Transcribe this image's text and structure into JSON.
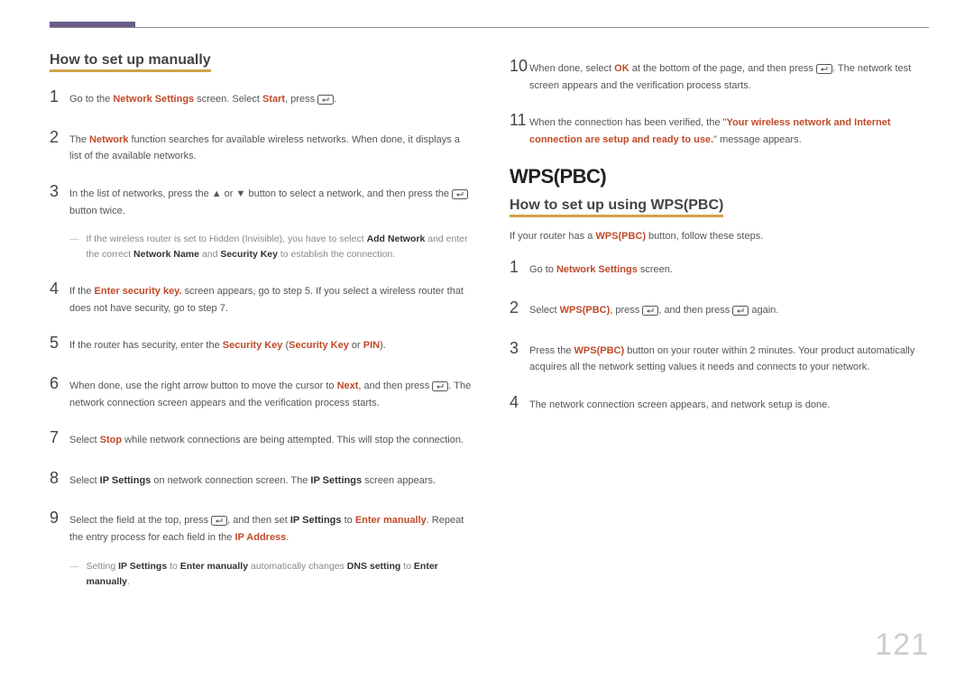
{
  "page_number": "121",
  "left": {
    "heading": "How to set up manually",
    "steps": [
      {
        "n": "1",
        "parts": [
          {
            "t": "Go to the "
          },
          {
            "b": "Network Settings",
            "k": true
          },
          {
            "t": " screen. Select "
          },
          {
            "b": "Start",
            "k": true
          },
          {
            "t": ", press "
          },
          {
            "icon": "enter"
          },
          {
            "t": "."
          }
        ]
      },
      {
        "n": "2",
        "parts": [
          {
            "t": "The "
          },
          {
            "b": "Network",
            "k": true
          },
          {
            "t": " function searches for available wireless networks. When done, it displays a list of the available networks."
          }
        ]
      },
      {
        "n": "3",
        "parts": [
          {
            "t": "In the list of networks, press the ▲ or ▼ button to select a network, and then press the  "
          },
          {
            "icon": "enter"
          },
          {
            "t": " button twice."
          }
        ]
      },
      {
        "note": true,
        "parts": [
          {
            "t": "If the wireless router is set to Hidden (Invisible), you have to select "
          },
          {
            "b": "Add Network"
          },
          {
            "t": " and enter the correct "
          },
          {
            "b": "Network Name"
          },
          {
            "t": " and "
          },
          {
            "b": "Security Key"
          },
          {
            "t": " to establish the connection."
          }
        ]
      },
      {
        "n": "4",
        "parts": [
          {
            "t": "If the "
          },
          {
            "b": "Enter security key.",
            "k": true
          },
          {
            "t": " screen appears, go to step 5. If you select a wireless router that does not have security, go to step 7."
          }
        ]
      },
      {
        "n": "5",
        "parts": [
          {
            "t": "If the router has security, enter the "
          },
          {
            "b": "Security Key",
            "k": true
          },
          {
            "t": " ("
          },
          {
            "b": "Security Key",
            "k": true
          },
          {
            "t": " or "
          },
          {
            "b": "PIN",
            "k": true
          },
          {
            "t": ")."
          }
        ]
      },
      {
        "n": "6",
        "parts": [
          {
            "t": "When done, use the right arrow button to move the cursor to "
          },
          {
            "b": "Next",
            "k": true
          },
          {
            "t": ", and then press "
          },
          {
            "icon": "enter"
          },
          {
            "t": ". The network connection screen appears and the verification process starts."
          }
        ]
      },
      {
        "n": "7",
        "parts": [
          {
            "t": "Select "
          },
          {
            "b": "Stop",
            "k": true
          },
          {
            "t": " while network connections are being attempted. This will stop the connection."
          }
        ]
      },
      {
        "n": "8",
        "parts": [
          {
            "t": "Select "
          },
          {
            "b": "IP Settings"
          },
          {
            "t": " on network connection screen. The "
          },
          {
            "b": "IP Settings"
          },
          {
            "t": " screen appears."
          }
        ]
      },
      {
        "n": "9",
        "parts": [
          {
            "t": "Select the field at the top, press "
          },
          {
            "icon": "enter"
          },
          {
            "t": ", and then set "
          },
          {
            "b": "IP Settings"
          },
          {
            "t": " to "
          },
          {
            "b": "Enter manually",
            "k": true
          },
          {
            "t": ". Repeat the entry process for each field in the "
          },
          {
            "b": "IP Address",
            "k": true
          },
          {
            "t": "."
          }
        ]
      },
      {
        "note": true,
        "parts": [
          {
            "t": "Setting "
          },
          {
            "b": "IP Settings"
          },
          {
            "t": " to "
          },
          {
            "b": "Enter manually"
          },
          {
            "t": " automatically changes "
          },
          {
            "b": "DNS setting"
          },
          {
            "t": " to "
          },
          {
            "b": "Enter manually"
          },
          {
            "t": "."
          }
        ]
      }
    ]
  },
  "right_top": {
    "steps": [
      {
        "n": "10",
        "parts": [
          {
            "t": "When done, select "
          },
          {
            "b": "OK",
            "k": true
          },
          {
            "t": " at the bottom of the page, and then press "
          },
          {
            "icon": "enter"
          },
          {
            "t": ". The network test screen appears and the verification process starts."
          }
        ]
      },
      {
        "n": "11",
        "parts": [
          {
            "t": "When the connection has been verified, the \""
          },
          {
            "b": "Your wireless network and Internet connection are setup and ready to use.",
            "k": true
          },
          {
            "t": "\" message appears."
          }
        ]
      }
    ]
  },
  "right_bottom": {
    "h2": "WPS(PBC)",
    "heading": "How to set up using WPS(PBC)",
    "intro_parts": [
      {
        "t": "If your router has a "
      },
      {
        "b": "WPS(PBC)",
        "k": true
      },
      {
        "t": " button, follow these steps."
      }
    ],
    "steps": [
      {
        "n": "1",
        "parts": [
          {
            "t": "Go to "
          },
          {
            "b": "Network Settings",
            "k": true
          },
          {
            "t": " screen."
          }
        ]
      },
      {
        "n": "2",
        "parts": [
          {
            "t": "Select "
          },
          {
            "b": "WPS(PBC)",
            "k": true
          },
          {
            "t": ", press  "
          },
          {
            "icon": "enter"
          },
          {
            "t": ", and then press "
          },
          {
            "icon": "enter"
          },
          {
            "t": " again."
          }
        ]
      },
      {
        "n": "3",
        "parts": [
          {
            "t": "Press the "
          },
          {
            "b": "WPS(PBC)",
            "k": true
          },
          {
            "t": " button on your router within 2 minutes. Your product automatically acquires all the network setting values it needs and connects to your network."
          }
        ]
      },
      {
        "n": "4",
        "parts": [
          {
            "t": "The network connection screen appears, and network setup is done."
          }
        ]
      }
    ]
  }
}
